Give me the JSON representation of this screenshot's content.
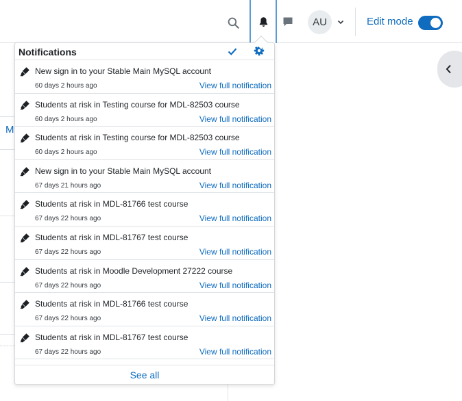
{
  "header": {
    "edit_mode_label": "Edit mode",
    "edit_mode_on": true,
    "avatar_initials": "AU",
    "accent_color": "#0f6cbf"
  },
  "background": {
    "partial_letter": "M"
  },
  "notifications": {
    "title": "Notifications",
    "see_all": "See all",
    "items": [
      {
        "subject": "New sign in to your Stable Main MySQL account",
        "time": "60 days 2 hours ago",
        "link": "View full notification"
      },
      {
        "subject": "Students at risk in Testing course for MDL-82503 course",
        "time": "60 days 2 hours ago",
        "link": "View full notification"
      },
      {
        "subject": "Students at risk in Testing course for MDL-82503 course",
        "time": "60 days 2 hours ago",
        "link": "View full notification"
      },
      {
        "subject": "New sign in to your Stable Main MySQL account",
        "time": "67 days 21 hours ago",
        "link": "View full notification"
      },
      {
        "subject": "Students at risk in MDL-81766 test course",
        "time": "67 days 22 hours ago",
        "link": "View full notification"
      },
      {
        "subject": "Students at risk in MDL-81767 test course",
        "time": "67 days 22 hours ago",
        "link": "View full notification"
      },
      {
        "subject": "Students at risk in Moodle Development 27222 course",
        "time": "67 days 22 hours ago",
        "link": "View full notification"
      },
      {
        "subject": "Students at risk in MDL-81766 test course",
        "time": "67 days 22 hours ago",
        "link": "View full notification"
      },
      {
        "subject": "Students at risk in MDL-81767 test course",
        "time": "67 days 22 hours ago",
        "link": "View full notification"
      }
    ]
  }
}
